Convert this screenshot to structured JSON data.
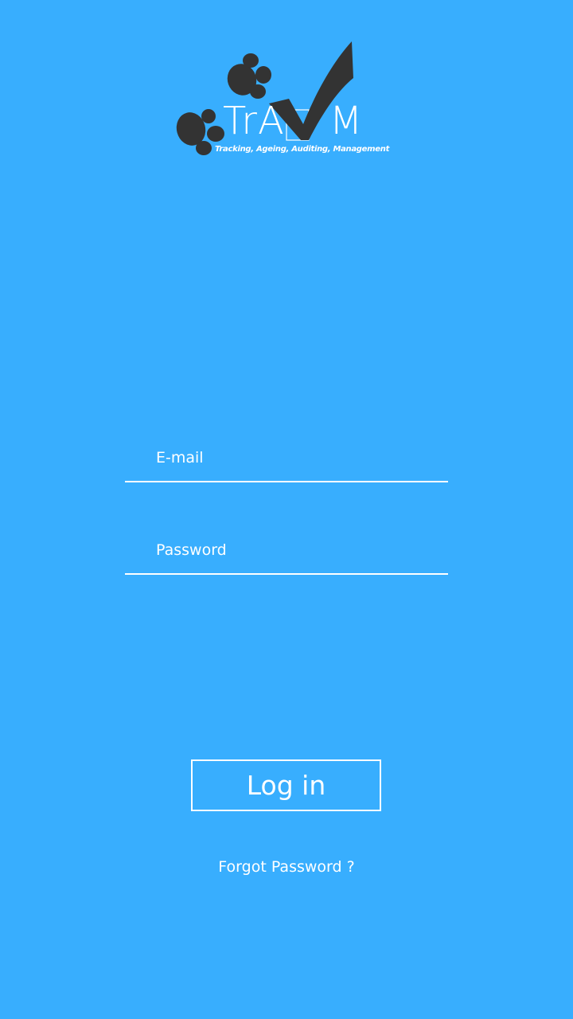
{
  "app": {
    "logo_text": "TrA",
    "logo_text_end": "M",
    "tagline": "Tracking, Ageing, Auditing, Management",
    "background_color": "#38aefe",
    "logo_color": "#333333"
  },
  "form": {
    "email_placeholder": "E-mail",
    "password_placeholder": "Password",
    "login_label": "Log in",
    "forgot_label": "Forgot Password ?"
  },
  "icons": {
    "logo_mark": "paw-prints-checkmark-icon"
  }
}
